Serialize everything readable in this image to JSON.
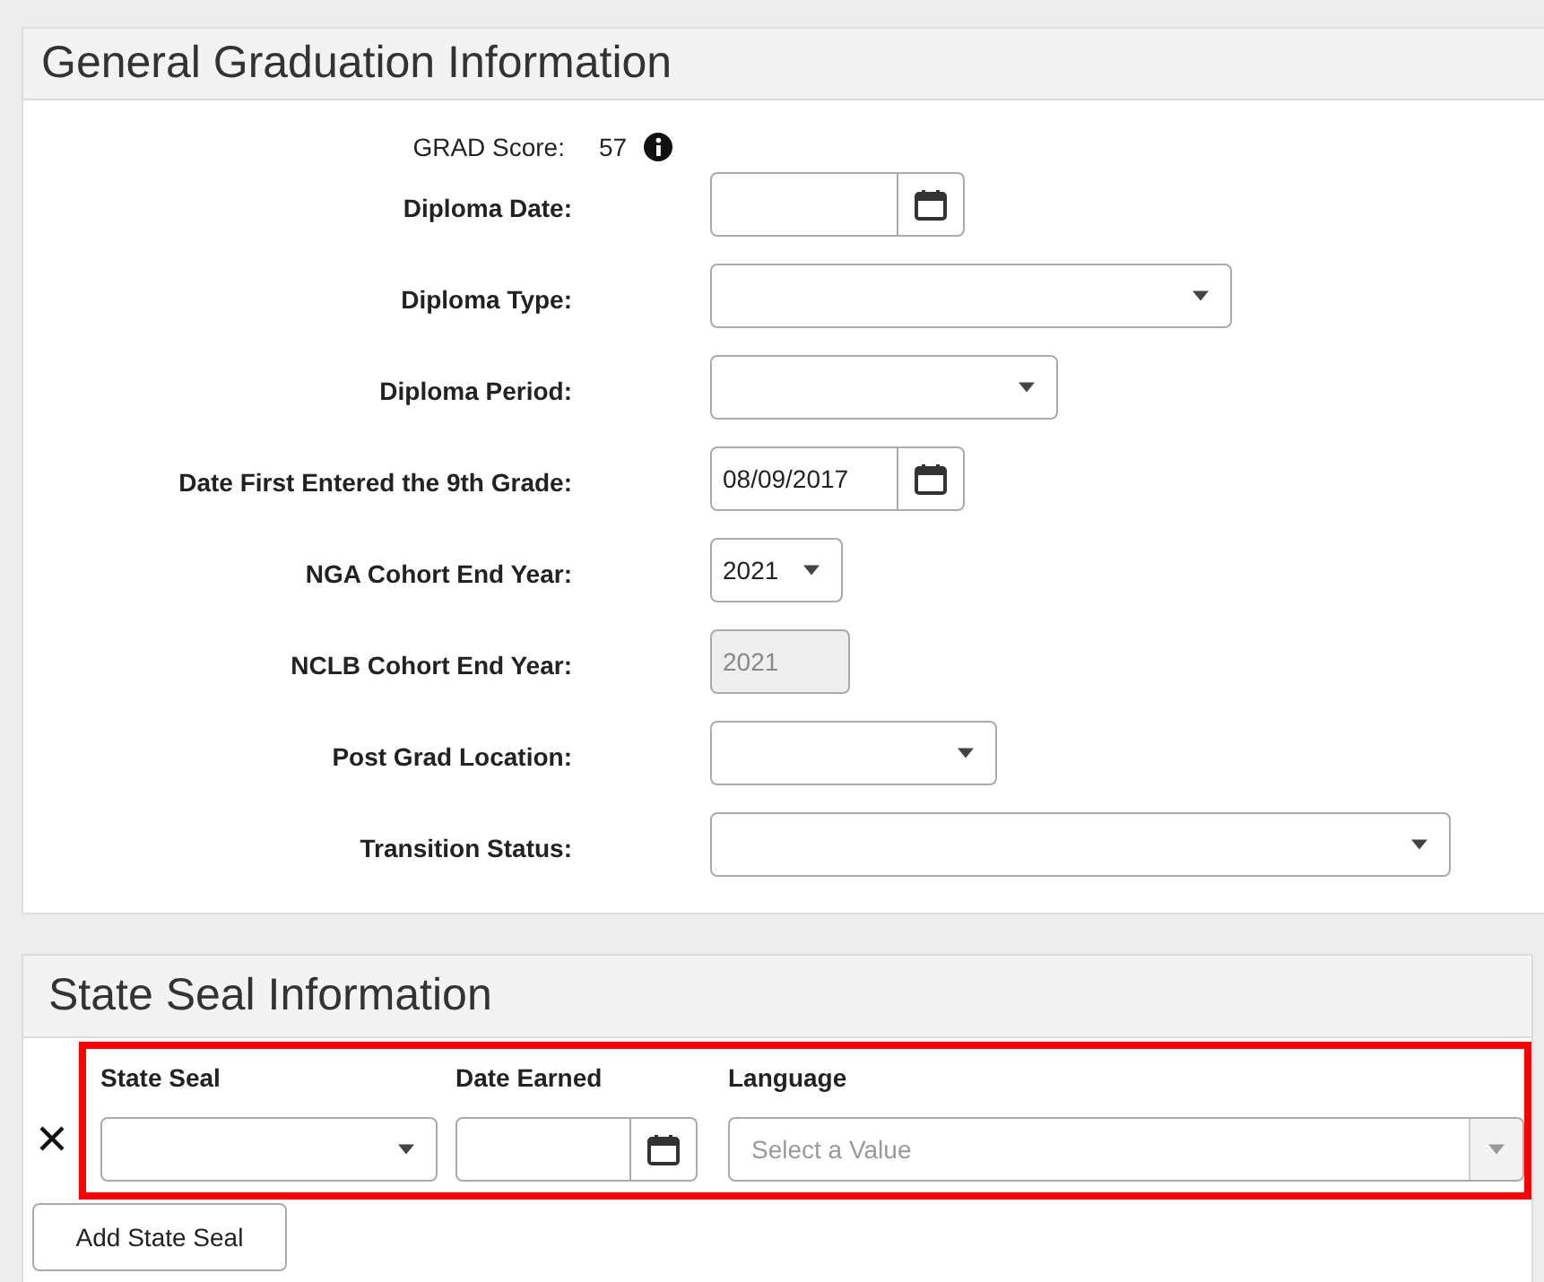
{
  "grad_panel": {
    "title": "General Graduation Information",
    "grad_score": {
      "label": "GRAD Score:",
      "value": "57"
    },
    "fields": [
      {
        "label": "Diploma Date:",
        "kind": "date",
        "disabled": false
      },
      {
        "label": "Diploma Type:",
        "kind": "select",
        "disabled": false
      },
      {
        "label": "Diploma Period:",
        "kind": "select",
        "disabled": false
      },
      {
        "label": "Date First Entered the 9th Grade:",
        "kind": "date",
        "value": "08/09/2017",
        "disabled": false
      },
      {
        "label": "NGA Cohort End Year:",
        "kind": "select",
        "value": "2021",
        "disabled": false
      },
      {
        "label": "NCLB Cohort End Year:",
        "kind": "text",
        "value": "2021",
        "disabled": true
      },
      {
        "label": "Post Grad Location:",
        "kind": "select",
        "disabled": false
      },
      {
        "label": "Transition Status:",
        "kind": "select",
        "disabled": false
      }
    ]
  },
  "seal_panel": {
    "title": "State Seal Information",
    "highlighted": true,
    "columns": [
      {
        "label": "State Seal",
        "kind": "select"
      },
      {
        "label": "Date Earned",
        "kind": "date"
      },
      {
        "label": "Language",
        "kind": "combo",
        "placeholder": "Select a Value"
      }
    ],
    "add_button": "Add State Seal"
  }
}
